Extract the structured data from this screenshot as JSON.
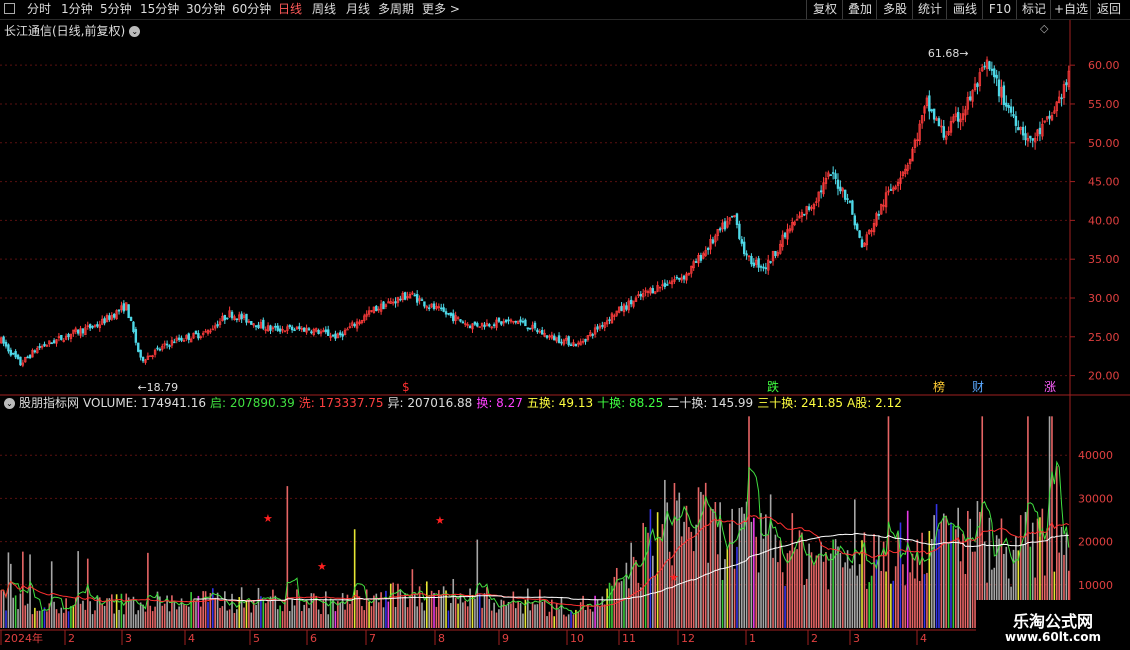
{
  "toolbar": {
    "periods": [
      "分时",
      "1分钟",
      "5分钟",
      "15分钟",
      "30分钟",
      "60分钟",
      "日线",
      "周线",
      "月线",
      "多周期",
      "更多 >"
    ],
    "active_period": "日线",
    "right_buttons": [
      "复权",
      "叠加",
      "多股",
      "统计",
      "画线",
      "F10",
      "标记",
      "+自选",
      "返回"
    ]
  },
  "main_chart": {
    "title": "长江通信(日线,前复权)",
    "max_label": "61.68",
    "min_label": "18.79",
    "y_labels": [
      "60.00",
      "55.00",
      "50.00",
      "45.00",
      "40.00",
      "35.00",
      "30.00",
      "25.00",
      "20.00"
    ],
    "markers": [
      {
        "text": "$",
        "color": "#ff3030"
      },
      {
        "text": "跌",
        "color": "#40ff40"
      },
      {
        "text": "榜",
        "color": "#ffcc33"
      },
      {
        "text": "财",
        "color": "#5aa8ff"
      },
      {
        "text": "涨",
        "color": "#ff60ff"
      }
    ]
  },
  "indicator": {
    "name": "股朋指标网",
    "fields": [
      {
        "label": "VOLUME: 174941.16",
        "color": "#dddddd"
      },
      {
        "label": "启: 207890.39",
        "color": "#40e040"
      },
      {
        "label": "洗: 173337.75",
        "color": "#ff4040"
      },
      {
        "label": "异: 207016.88",
        "color": "#dddddd"
      },
      {
        "label": "换: 8.27",
        "color": "#ff40ff"
      },
      {
        "label": "五换: 49.13",
        "color": "#ffff40"
      },
      {
        "label": "十换: 88.25",
        "color": "#40ff40"
      },
      {
        "label": "二十换: 145.99",
        "color": "#dddddd"
      },
      {
        "label": "三十换: 241.85",
        "color": "#ffff40"
      },
      {
        "label": "A股: 2.12",
        "color": "#ffff40"
      }
    ],
    "y_labels": [
      "40000",
      "30000",
      "20000",
      "10000"
    ]
  },
  "x_axis": {
    "labels": [
      "2024年",
      "2",
      "3",
      "4",
      "5",
      "6",
      "7",
      "8",
      "9",
      "10",
      "11",
      "12",
      "1",
      "2",
      "3",
      "4"
    ]
  },
  "chart_data": {
    "type": "candlestick",
    "title": "长江通信(日线,前复权)",
    "price_ylim": [
      17.5,
      63.5
    ],
    "volume_ylim": [
      0,
      50000
    ],
    "price_anchors": [
      [
        0,
        24.5
      ],
      [
        8,
        21.5
      ],
      [
        15,
        23.5
      ],
      [
        30,
        25.5
      ],
      [
        40,
        26.5
      ],
      [
        52,
        29
      ],
      [
        58,
        22
      ],
      [
        72,
        24.5
      ],
      [
        85,
        25.5
      ],
      [
        95,
        28
      ],
      [
        112,
        26
      ],
      [
        128,
        26
      ],
      [
        140,
        25
      ],
      [
        155,
        28.5
      ],
      [
        170,
        30.5
      ],
      [
        178,
        29
      ],
      [
        195,
        26.5
      ],
      [
        215,
        27
      ],
      [
        228,
        25
      ],
      [
        240,
        24
      ],
      [
        255,
        28
      ],
      [
        270,
        31
      ],
      [
        285,
        33
      ],
      [
        300,
        39
      ],
      [
        305,
        40.5
      ],
      [
        310,
        35
      ],
      [
        318,
        34
      ],
      [
        328,
        39
      ],
      [
        337,
        42
      ],
      [
        345,
        46
      ],
      [
        352,
        43
      ],
      [
        358,
        36.5
      ],
      [
        368,
        43
      ],
      [
        378,
        48
      ],
      [
        385,
        55
      ],
      [
        392,
        51
      ],
      [
        400,
        54
      ],
      [
        410,
        60
      ],
      [
        418,
        55
      ],
      [
        428,
        50
      ],
      [
        436,
        53
      ],
      [
        445,
        59
      ]
    ],
    "volume_anchors": [
      [
        0,
        7000
      ],
      [
        20,
        5000
      ],
      [
        50,
        6000
      ],
      [
        80,
        6500
      ],
      [
        110,
        7000
      ],
      [
        140,
        6000
      ],
      [
        170,
        8000
      ],
      [
        200,
        7000
      ],
      [
        230,
        5000
      ],
      [
        250,
        6000
      ],
      [
        265,
        17000
      ],
      [
        280,
        28000
      ],
      [
        300,
        22000
      ],
      [
        320,
        20000
      ],
      [
        340,
        18000
      ],
      [
        360,
        16000
      ],
      [
        380,
        20000
      ],
      [
        400,
        23000
      ],
      [
        420,
        19000
      ],
      [
        445,
        22000
      ]
    ],
    "max_price": 61.68,
    "min_price": 18.79,
    "count": 445
  }
}
